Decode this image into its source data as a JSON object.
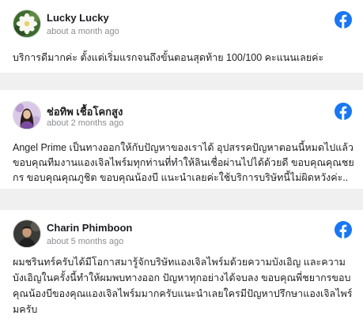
{
  "reviews": [
    {
      "author": "Lucky Lucky",
      "time": "about a month ago",
      "text": "บริการดีมากค่ะ ตั้งแต่เริ่มแรกจนถึงขั้นตอนสุดท้าย 100/100 คะแนนเลยค่ะ",
      "platform_icon": "facebook-icon",
      "avatar": "flower-photo"
    },
    {
      "author": "ช่อทิพ เชื้อโคกสูง",
      "time": "about 2 months ago",
      "text": "Angel Prime เป็นทางออกให้กับปัญหาของเราได้ อุปสรรคปัญหาตอนนี้หมดไปแล้ว ขอบคุณทีมงานแองเจิลไพร์มทุกท่านที่ทำให้ลินเชื่อผ่านไปได้ด้วยดี ขอบคุณคุณชยกร ขอบคุณคุณภูชิต ขอบคุณน้องบี แนะนำเลยค่ะใช้บริการบริษัทนี้ไม่ผิดหวังค่ะ..",
      "platform_icon": "facebook-icon",
      "avatar": "woman-photo"
    },
    {
      "author": "Charin Phimboon",
      "time": "about 5 months ago",
      "text": "ผมชรินทร์ครับได้มีโอกาสมารู้จักบริษัทแองเจิลไพร์มด้วยความบังเอิญ และความบังเอิญในครั้งนี้ทำให้ผมพบทางออก ปัญหาทุกอย่างได้จบลง ขอบคุณพี่ชยากรขอบคุณน้องบีของคุณแองเจิลไพร์มมากครับแนะนำเลยใครมีปัญหาปรึกษาแองเจิลไพร์มครับ",
      "platform_icon": "facebook-icon",
      "avatar": "man-photo"
    }
  ],
  "colors": {
    "facebook_blue": "#1877f2",
    "name_text": "#1c1e21",
    "time_text": "#8a8d91"
  }
}
